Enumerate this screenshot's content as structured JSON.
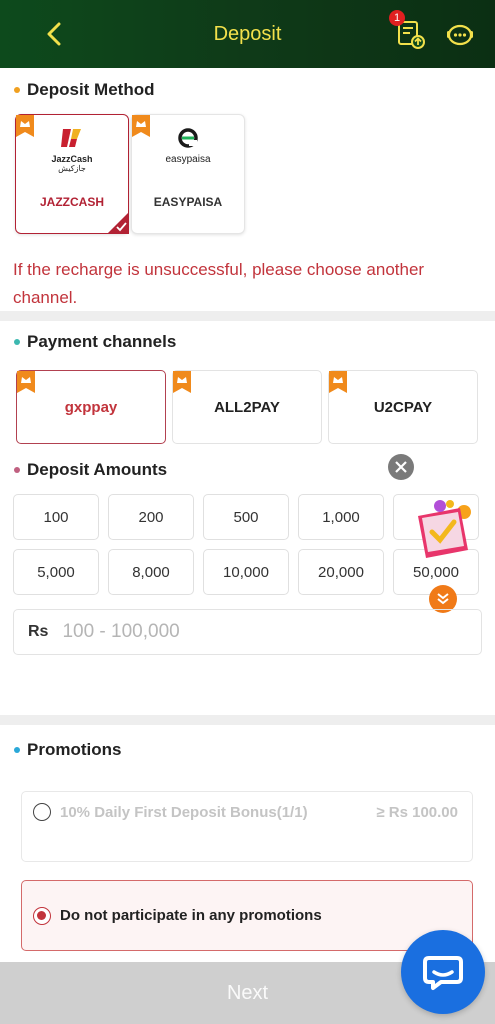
{
  "header": {
    "title": "Deposit",
    "badge_count": "1",
    "title_color": "#f2e04b",
    "bg_color": "#0d4a1c"
  },
  "deposit_method": {
    "title": "Deposit Method",
    "dot_color": "#f0a020",
    "methods": [
      {
        "logo_line1": "JazzCash",
        "logo_line2": "جازکیش",
        "label": "JAZZCASH",
        "selected": true
      },
      {
        "logo_text": "easypaisa",
        "label": "EASYPAISA",
        "selected": false
      }
    ],
    "warning": "If the recharge is unsuccessful, please choose another channel."
  },
  "payment_channels": {
    "title": "Payment channels",
    "dot_color": "#3cb8b0",
    "channels": [
      {
        "label": "gxppay",
        "selected": true
      },
      {
        "label": "ALL2PAY",
        "selected": false
      },
      {
        "label": "U2CPAY",
        "selected": false
      }
    ]
  },
  "deposit_amounts": {
    "title": "Deposit Amounts",
    "dot_color": "#c06080",
    "amounts": [
      "100",
      "200",
      "500",
      "1,000",
      "5,000",
      "8,000",
      "10,000",
      "20,000",
      "50,000"
    ],
    "currency_label": "Rs",
    "input_placeholder": "100 - 100,000",
    "input_value": ""
  },
  "promotions": {
    "title": "Promotions",
    "dot_color": "#2aa8d8",
    "options": [
      {
        "label": "10% Daily First Deposit Bonus(1/1)",
        "amount": "≥ Rs 100.00",
        "disabled": true,
        "selected": false
      },
      {
        "label": "Do not participate in any promotions",
        "selected": true
      }
    ]
  },
  "footer": {
    "next_label": "Next"
  },
  "accent_color": "#c2343c",
  "icons": [
    "chevron-left-icon",
    "upload-record-icon",
    "customer-service-icon",
    "close-icon",
    "gift-icon",
    "double-chevron-down-icon",
    "chat-bubble-icon",
    "crown-tag-icon",
    "checkmark-icon"
  ]
}
